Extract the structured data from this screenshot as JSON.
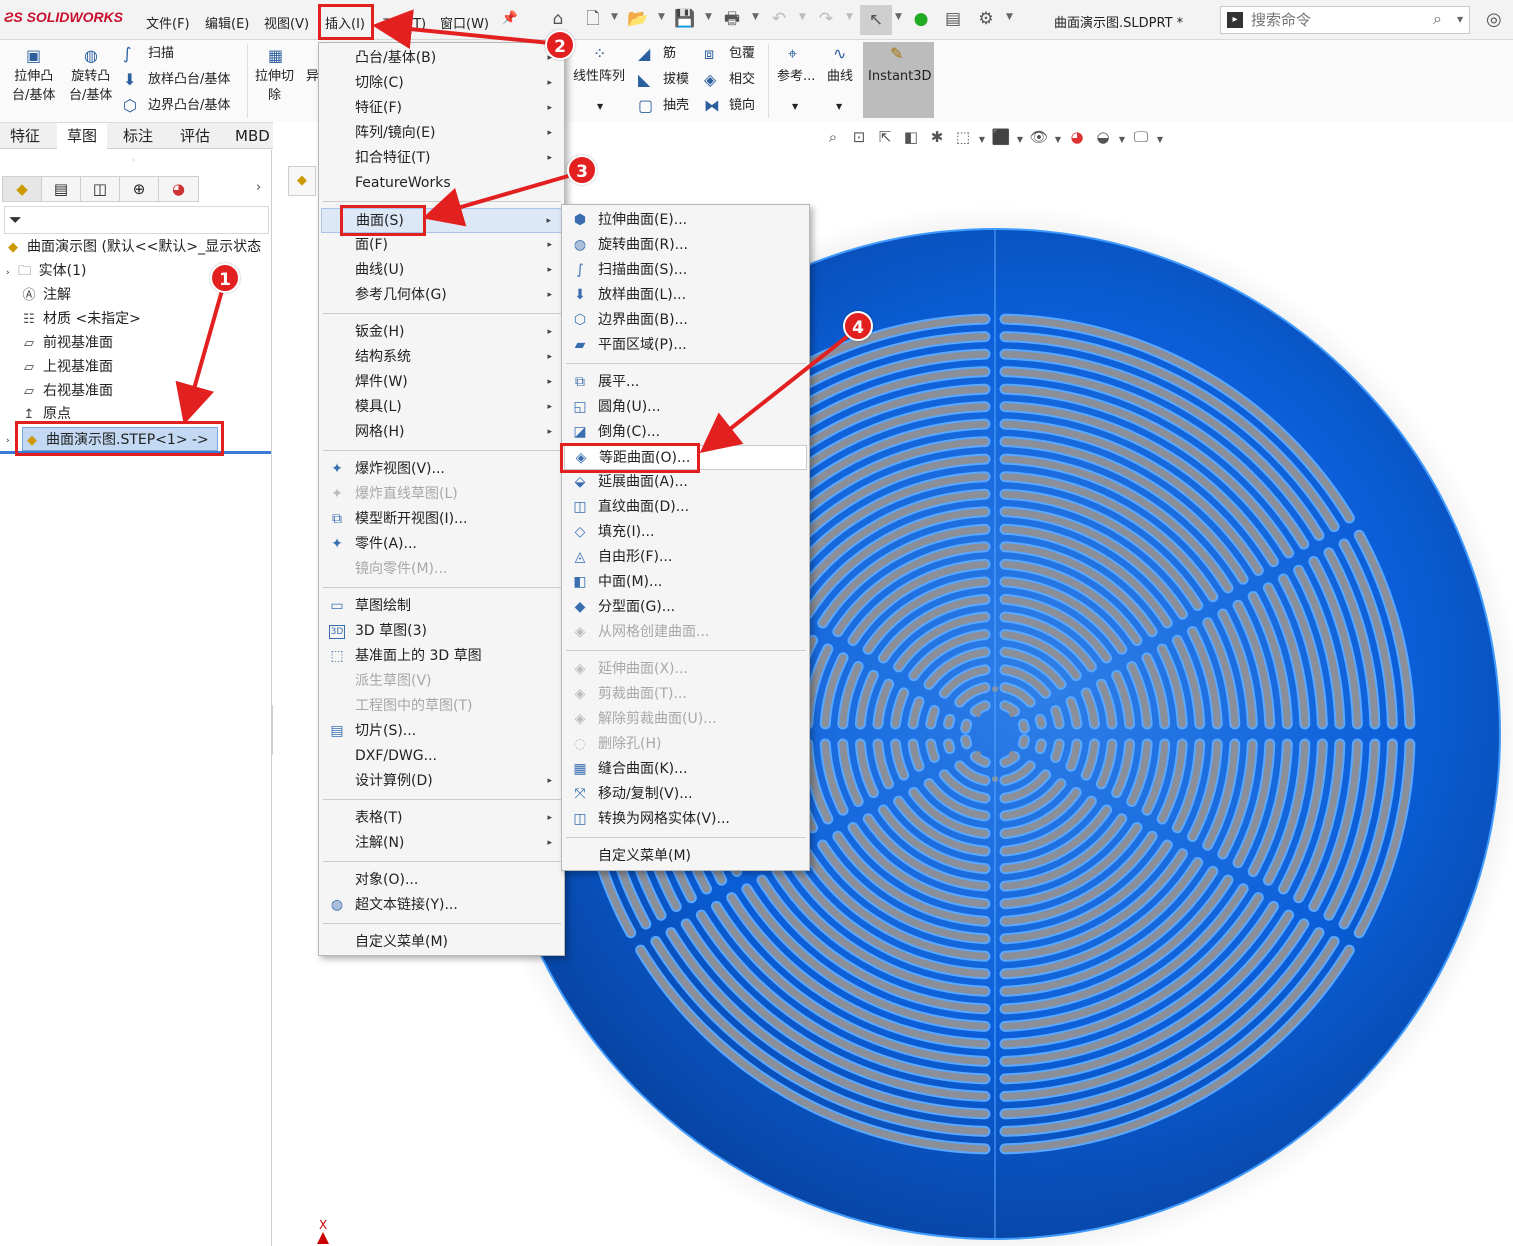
{
  "app": {
    "logo": "SOLIDWORKS",
    "doc_title": "曲面演示图.SLDPRT *"
  },
  "menubar": [
    "文件(F)",
    "编辑(E)",
    "视图(V)",
    "插入(I)",
    "工具(T)",
    "窗口(W)"
  ],
  "search": {
    "placeholder": "搜索命令"
  },
  "ribbon": {
    "extrude_boss": [
      "拉伸凸",
      "台/基体"
    ],
    "revolve_boss": [
      "旋转凸",
      "台/基体"
    ],
    "sweep": "扫描",
    "loft_boss": "放样凸台/基体",
    "boundary_boss": "边界凸台/基体",
    "extrude_cut": [
      "拉伸切",
      "除"
    ],
    "extra": "异",
    "linear_pattern": "线性阵列",
    "rib": "筋",
    "draft": "拔模",
    "shell": "抽壳",
    "wrap": "包覆",
    "intersect": "相交",
    "mirror": "镜向",
    "reference": "参考...",
    "curves": "曲线",
    "instant3d": "Instant3D"
  },
  "tabs": [
    "特征",
    "草图",
    "标注",
    "评估",
    "MBD Dimen"
  ],
  "tree": {
    "root": "曲面演示图 (默认<<默认>_显示状态",
    "items": [
      "实体(1)",
      "注解",
      "材质 <未指定>",
      "前视基准面",
      "上视基准面",
      "右视基准面",
      "原点"
    ],
    "selected": "曲面演示图.STEP<1> ->"
  },
  "insert_menu": {
    "items": [
      "凸台/基体(B)",
      "切除(C)",
      "特征(F)",
      "阵列/镜向(E)",
      "扣合特征(T)",
      "FeatureWorks",
      "曲面(S)",
      "面(F)",
      "曲线(U)",
      "参考几何体(G)",
      "钣金(H)",
      "结构系统",
      "焊件(W)",
      "模具(L)",
      "网格(H)",
      "爆炸视图(V)...",
      "爆炸直线草图(L)",
      "模型断开视图(I)...",
      "零件(A)...",
      "镜向零件(M)...",
      "草图绘制",
      "3D 草图(3)",
      "基准面上的 3D 草图",
      "派生草图(V)",
      "工程图中的草图(T)",
      "切片(S)...",
      "DXF/DWG...",
      "设计算例(D)",
      "表格(T)",
      "注解(N)",
      "对象(O)...",
      "超文本链接(Y)...",
      "自定义菜单(M)"
    ]
  },
  "surface_menu": {
    "items": [
      "拉伸曲面(E)...",
      "旋转曲面(R)...",
      "扫描曲面(S)...",
      "放样曲面(L)...",
      "边界曲面(B)...",
      "平面区域(P)...",
      "展平...",
      "圆角(U)...",
      "倒角(C)...",
      "等距曲面(O)...",
      "延展曲面(A)...",
      "直纹曲面(D)...",
      "填充(I)...",
      "自由形(F)...",
      "中面(M)...",
      "分型面(G)...",
      "从网格创建曲面...",
      "延伸曲面(X)...",
      "剪裁曲面(T)...",
      "解除剪裁曲面(U)...",
      "删除孔(H)",
      "缝合曲面(K)...",
      "移动/复制(V)...",
      "转换为网格实体(V)...",
      "自定义菜单(M)"
    ]
  },
  "badges": [
    "1",
    "2",
    "3",
    "4"
  ],
  "axis_label": "X",
  "colors": {
    "model_blue": "#0a5ccc",
    "annotation_red": "#e32020"
  }
}
